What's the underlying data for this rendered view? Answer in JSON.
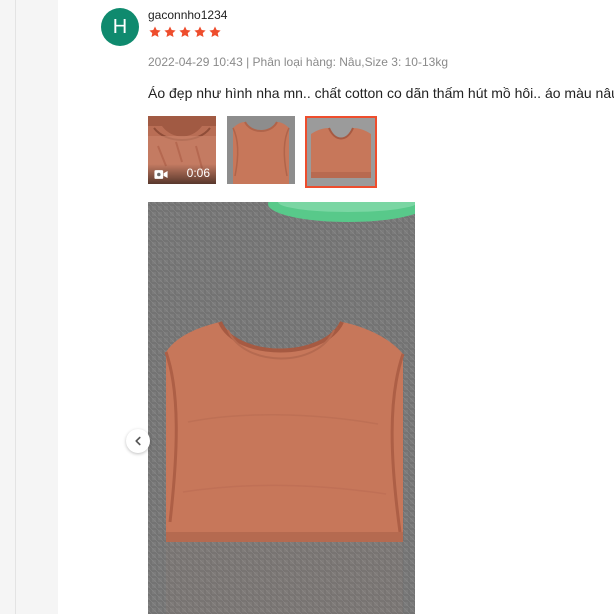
{
  "review": {
    "avatar_initial": "H",
    "username": "gaconnho1234",
    "rating": 5,
    "meta": "2022-04-29 10:43 | Phân loại hàng: Nâu,Size 3: 10-13kg",
    "comment": "Áo đẹp như hình nha mn.. chất cotton co dãn thấm hút mồ hôi.. áo màu nâu",
    "video_duration": "0:06"
  },
  "colors": {
    "avatar_bg": "#0f8a6e",
    "star": "#ee4d2d",
    "selected_border": "#ee4d2d",
    "shirt": "#c7775a"
  },
  "icons": {
    "star": "star-icon",
    "video": "video-camera-icon",
    "prev": "chevron-left-icon"
  }
}
